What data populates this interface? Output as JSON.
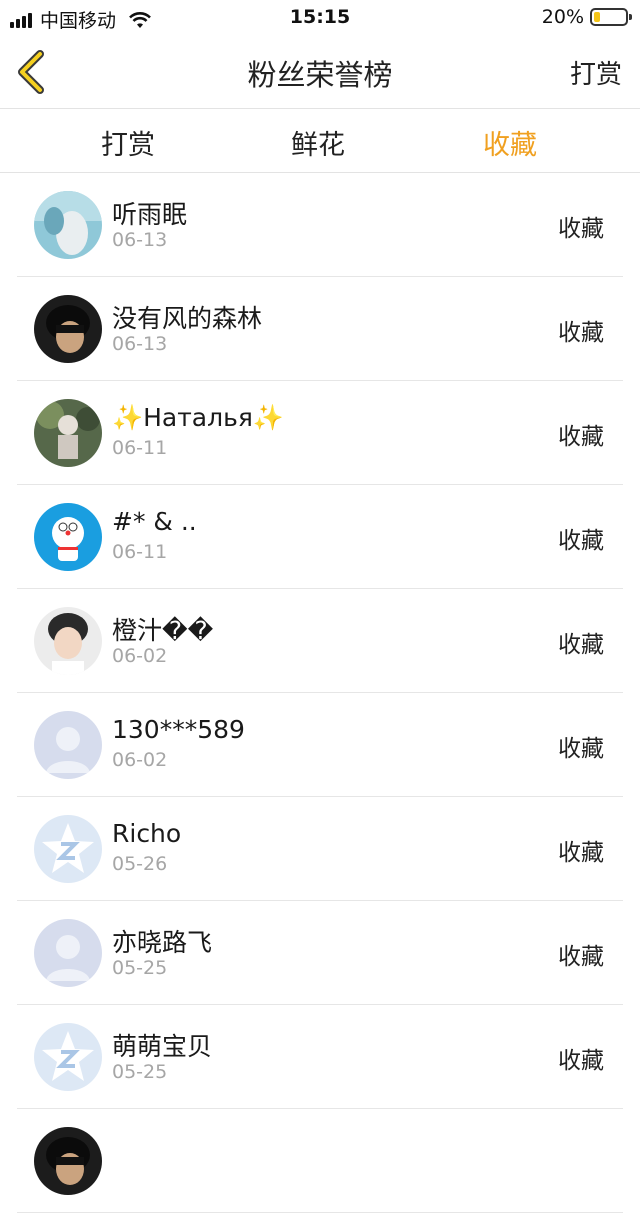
{
  "status_bar": {
    "carrier": "中国移动",
    "time": "15:15",
    "battery": "20%",
    "battery_level": 0.2
  },
  "nav": {
    "title": "粉丝荣誉榜",
    "right_label": "打赏"
  },
  "tabs": [
    {
      "label": "打赏"
    },
    {
      "label": "鲜花"
    },
    {
      "label": "收藏"
    }
  ],
  "active_tab": 2,
  "accent_color": "#f0a020",
  "rows": [
    {
      "name": "听雨眠",
      "date": "06-13",
      "action": "收藏",
      "avatar": "photo-blue"
    },
    {
      "name": "没有风的森林",
      "date": "06-13",
      "action": "收藏",
      "avatar": "photo-dark"
    },
    {
      "name": "✨Наталья✨",
      "date": "06-11",
      "action": "收藏",
      "avatar": "photo-green"
    },
    {
      "name": "#* & ..",
      "date": "06-11",
      "action": "收藏",
      "avatar": "doraemon"
    },
    {
      "name": "橙汁��",
      "date": "06-02",
      "action": "收藏",
      "avatar": "photo-boy"
    },
    {
      "name": "130***589",
      "date": "06-02",
      "action": "收藏",
      "avatar": "default-person"
    },
    {
      "name": "Richo",
      "date": "05-26",
      "action": "收藏",
      "avatar": "qq-star"
    },
    {
      "name": "亦晓路飞",
      "date": "05-25",
      "action": "收藏",
      "avatar": "default-person"
    },
    {
      "name": "萌萌宝贝",
      "date": "05-25",
      "action": "收藏",
      "avatar": "qq-star"
    }
  ]
}
